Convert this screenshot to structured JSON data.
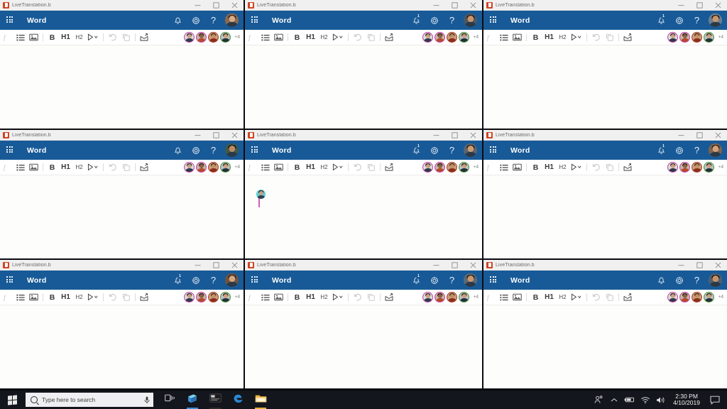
{
  "window": {
    "title": "LiveTranslation.b",
    "app_icon": "office-word-icon",
    "controls": {
      "minimize": "─",
      "maximize": "□",
      "close": "✕"
    }
  },
  "appbar": {
    "waffle_icon": "app-launcher-waffle-icon",
    "app_name": "Word",
    "notifications_icon": "bell-icon",
    "notifications_badge": "1",
    "settings_icon": "gear-icon",
    "help_icon": "help-question-icon",
    "account_icon": "account-avatar"
  },
  "toolbar": {
    "items": [
      {
        "name": "format-painter-icon",
        "label": "ƒ",
        "kind": "icon",
        "dim": true
      },
      {
        "name": "bulleted-list-icon",
        "label": "☰",
        "kind": "list"
      },
      {
        "name": "insert-picture-icon",
        "label": "Ὓc",
        "kind": "image"
      },
      {
        "name": "separator-1",
        "kind": "sep"
      },
      {
        "name": "bold-button",
        "label": "B",
        "kind": "bold"
      },
      {
        "name": "heading-1-button",
        "label": "H1",
        "kind": "h1"
      },
      {
        "name": "heading-2-button",
        "label": "H2",
        "kind": "h2"
      },
      {
        "name": "dictate-button",
        "label": "ᴰ",
        "kind": "dictate"
      },
      {
        "name": "separator-2",
        "kind": "sep"
      },
      {
        "name": "undo-button",
        "label": "↶",
        "kind": "undo",
        "dim": true
      },
      {
        "name": "redo-button",
        "label": "⧉",
        "kind": "redo",
        "dim": true
      },
      {
        "name": "separator-3",
        "kind": "sep"
      },
      {
        "name": "share-button",
        "label": "↪",
        "kind": "share"
      }
    ],
    "collaborators": [
      {
        "name": "collaborator-avatar-1",
        "ring": "#d23bb0",
        "skin": "#c8a183",
        "hair": "#241b16",
        "shirt": "#2d3b4a",
        "bg": "#dcdcdc"
      },
      {
        "name": "collaborator-avatar-2",
        "ring": "#d23bb0",
        "skin": "#8d6247",
        "hair": "#171110",
        "shirt": "#b44a2a",
        "bg": "#c9b6a6"
      },
      {
        "name": "collaborator-avatar-3",
        "ring": "#b33a1f",
        "skin": "#c68e66",
        "hair": "#2b1d14",
        "shirt": "#8a2f1c",
        "bg": "#caa07c"
      },
      {
        "name": "collaborator-avatar-4",
        "ring": "#4c9a2a",
        "skin": "#cfa078",
        "hair": "#1c1510",
        "shirt": "#22303d",
        "bg": "#b9c3cc"
      }
    ],
    "overflow_count": "+4"
  },
  "cursor": {
    "name": "collaborator-cursor-flag",
    "caret_color": "#cf5fb5",
    "avatar_bg": "#5fd0d8",
    "skin": "#caa182",
    "hair": "#2a1d17"
  },
  "windows": [
    {
      "id": "window-1",
      "badge": false,
      "cursor": false,
      "me_bg": "#8a6a52",
      "me_hair": "#2a1a12",
      "me_skin": "#d7ab87"
    },
    {
      "id": "window-2",
      "badge": true,
      "cursor": false,
      "me_bg": "#4a5866",
      "me_hair": "#241812",
      "me_skin": "#c9956e"
    },
    {
      "id": "window-3",
      "badge": true,
      "cursor": false,
      "me_bg": "#6b7f92",
      "me_hair": "#1d1511",
      "me_skin": "#c7966f"
    },
    {
      "id": "window-4",
      "badge": false,
      "cursor": false,
      "me_bg": "#3d5a4a",
      "me_hair": "#16110e",
      "me_skin": "#bb8a66"
    },
    {
      "id": "window-5",
      "badge": true,
      "cursor": true,
      "me_bg": "#5a6472",
      "me_hair": "#201812",
      "me_skin": "#cb9b74"
    },
    {
      "id": "window-6",
      "badge": true,
      "cursor": false,
      "me_bg": "#7a6452",
      "me_hair": "#261a13",
      "me_skin": "#d2a07a"
    },
    {
      "id": "window-7",
      "badge": true,
      "cursor": false,
      "me_bg": "#6d5444",
      "me_hair": "#2b1c14",
      "me_skin": "#d4a57f"
    },
    {
      "id": "window-8",
      "badge": true,
      "cursor": false,
      "me_bg": "#5b6a78",
      "me_hair": "#1f1712",
      "me_skin": "#c99870"
    },
    {
      "id": "window-9",
      "badge": false,
      "cursor": false,
      "me_bg": "#4f6070",
      "me_hair": "#1a1410",
      "me_skin": "#c59268"
    }
  ],
  "taskbar": {
    "start_icon": "windows-start-icon",
    "search": {
      "icon": "search-circle-icon",
      "placeholder": "Type here to search",
      "mic_icon": "microphone-icon"
    },
    "apps": [
      {
        "name": "task-view-icon",
        "color": "#d7d7d7",
        "open": false
      },
      {
        "name": "microsoft-store-icon",
        "color": "#3b8fd4",
        "open": true
      },
      {
        "name": "dark-app-icon",
        "color": "#2b2b2b",
        "open": true
      },
      {
        "name": "microsoft-edge-icon",
        "color": "#2c8ad6",
        "open": false
      },
      {
        "name": "file-explorer-icon",
        "color": "#e8b23a",
        "open": true
      }
    ],
    "tray": [
      {
        "name": "people-icon"
      },
      {
        "name": "show-hidden-icons-chevron"
      },
      {
        "name": "battery-icon"
      },
      {
        "name": "wifi-icon"
      },
      {
        "name": "volume-icon"
      }
    ],
    "clock": {
      "time": "2:30 PM",
      "date": "4/10/2019"
    },
    "action_center_icon": "action-center-icon"
  },
  "colors": {
    "appbar": "#185a97",
    "titlebar": "#f0f0f0",
    "canvas": "#fdfdfb",
    "taskbar": "#13161c",
    "desktop": "#101018"
  }
}
